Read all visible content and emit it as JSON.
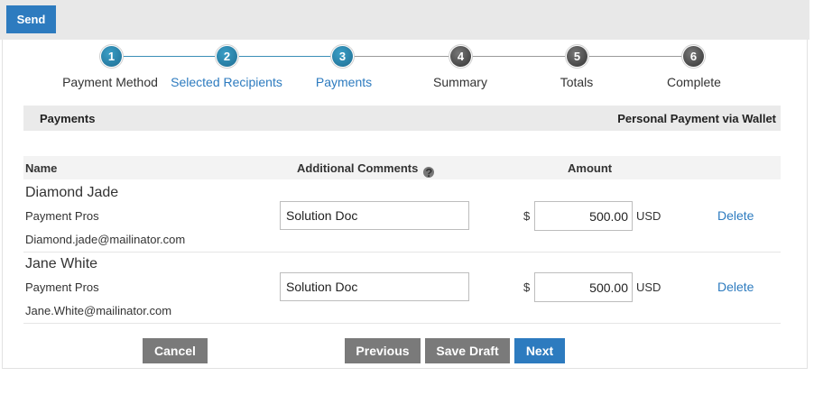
{
  "toolbar": {
    "send_label": "Send"
  },
  "steps": [
    {
      "number": "1",
      "label": "Payment Method",
      "status": "complete"
    },
    {
      "number": "2",
      "label": "Selected Recipients",
      "status": "complete"
    },
    {
      "number": "3",
      "label": "Payments",
      "status": "current"
    },
    {
      "number": "4",
      "label": "Summary",
      "status": "pending"
    },
    {
      "number": "5",
      "label": "Totals",
      "status": "pending"
    },
    {
      "number": "6",
      "label": "Complete",
      "status": "pending"
    }
  ],
  "section": {
    "title": "Payments",
    "payment_type": "Personal Payment via Wallet"
  },
  "table": {
    "headers": {
      "name": "Name",
      "comments": "Additional Comments",
      "amount": "Amount"
    },
    "rows": [
      {
        "name": "Diamond Jade",
        "company": "Payment Pros",
        "email": "Diamond.jade@mailinator.com",
        "comment": "Solution Doc",
        "currency_symbol": "$",
        "amount": "500.00",
        "currency": "USD",
        "delete_label": "Delete"
      },
      {
        "name": "Jane White",
        "company": "Payment Pros",
        "email": "Jane.White@mailinator.com",
        "comment": "Solution Doc",
        "currency_symbol": "$",
        "amount": "500.00",
        "currency": "USD",
        "delete_label": "Delete"
      }
    ]
  },
  "actions": {
    "cancel_label": "Cancel",
    "previous_label": "Previous",
    "save_draft_label": "Save Draft",
    "next_label": "Next"
  },
  "colors": {
    "primary": "#2d7bbf",
    "step_active": "#1f6d92",
    "step_pending": "#333333",
    "secondary_button": "#7a7a7a"
  },
  "icons": {
    "help": "question-circle-icon"
  }
}
